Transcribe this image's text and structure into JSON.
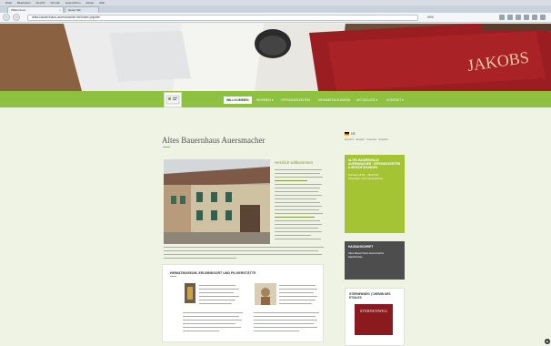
{
  "browser": {
    "menu": [
      "Datei",
      "Bearbeiten",
      "Ansicht",
      "Chronik",
      "Lesezeichen",
      "Extras",
      "Hilfe"
    ],
    "tabs": [
      {
        "label": "Willkommen"
      },
      {
        "label": "Neuer Tab"
      }
    ],
    "url": "altes-bauernhaus-auersmacher.de/index.php/de/",
    "zoom": "90%"
  },
  "site": {
    "nav": [
      {
        "label": "WILLKOMMEN"
      },
      {
        "label": "WOHNEN ▾"
      },
      {
        "label": "ÖFFNUNGSZEITEN"
      },
      {
        "label": "VERANSTALTUNGEN"
      },
      {
        "label": "AKTUELLES ▾"
      },
      {
        "label": "KONTAKT ▾"
      }
    ],
    "hero_book_text": "JAKOBS"
  },
  "main": {
    "title": "Altes Bauernhaus Auersmacher",
    "welcome_heading": "Herzlich willkommen!",
    "regional_title": "HEIMATMUSEUM, ERLEBNISORT UND PILGERSTÄTTE"
  },
  "sidebar": {
    "language": "DE",
    "language_sub": "Deutsch · English · Français · Español",
    "green_box": {
      "heading": "ALTES BAUERNHAUS AUERSMACHER · ÖFFNUNGSZEITEN & BESICHTIGUNGEN",
      "lines": [
        "Sonntag 14:00 – 18:00 Uhr",
        "Führungen nach Vereinbarung"
      ]
    },
    "dark_box": {
      "heading": "HAUSANSCHRIFT",
      "lines": [
        "Altes Bauernhaus Auersmacher",
        "Saarbrücken"
      ]
    },
    "light_box": {
      "heading": "STERNENWEG | CHEMIN DES ETOILES",
      "logo_text": "STERNENWEG"
    }
  },
  "colors": {
    "accent_green": "#8dc13f",
    "sidebar_green": "#a4c434",
    "dark_box": "#4d4d4d",
    "sternenweg_red": "#8a1a1e"
  }
}
